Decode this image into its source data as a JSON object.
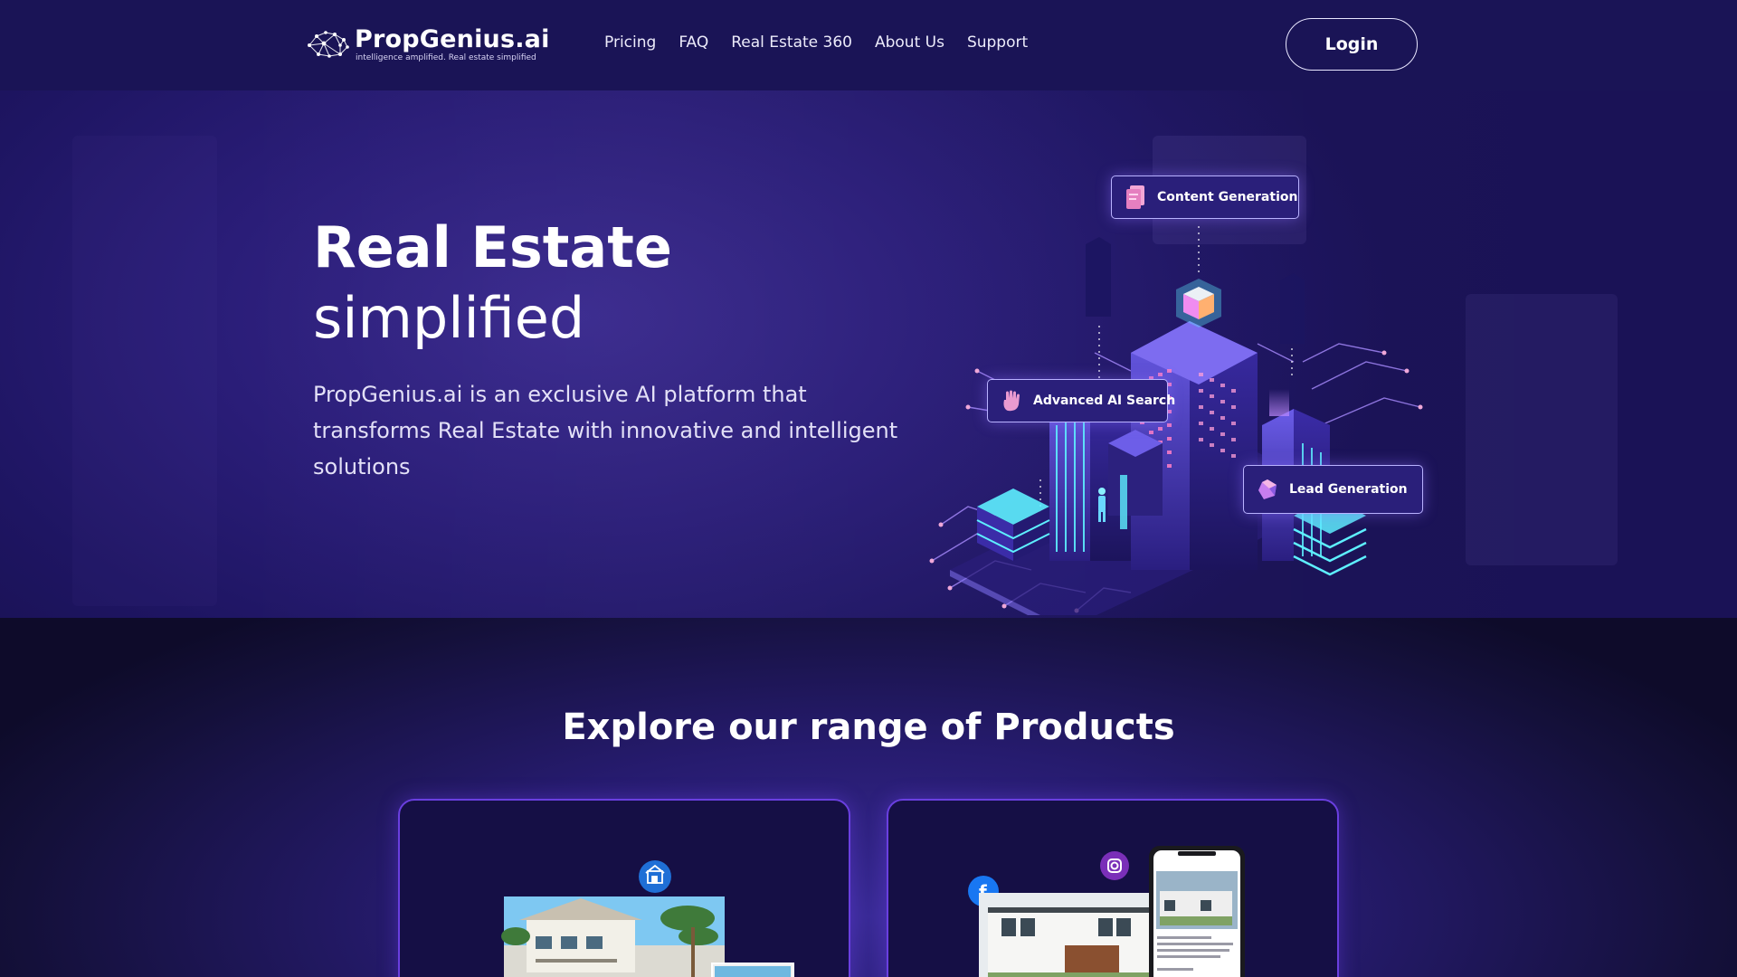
{
  "brand": {
    "name": "PropGenius.ai",
    "tagline": "intelligence amplified. Real estate simplified"
  },
  "nav": {
    "items": [
      {
        "label": "Pricing"
      },
      {
        "label": "FAQ"
      },
      {
        "label": "Real Estate 360"
      },
      {
        "label": "About Us"
      },
      {
        "label": "Support"
      }
    ],
    "login_label": "Login"
  },
  "hero": {
    "title": "Real Estate",
    "subtitle": "simplified",
    "description": "PropGenius.ai is an exclusive AI platform that transforms Real Estate with innovative and intelligent solutions",
    "features": [
      {
        "label": "Content Generation",
        "icon": "document-stack-icon"
      },
      {
        "label": "Advanced AI Search",
        "icon": "hand-pointer-icon"
      },
      {
        "label": "Lead Generation",
        "icon": "gem-icon"
      }
    ]
  },
  "products": {
    "heading": "Explore our range of Products",
    "cards": [
      {
        "icon": "building-icon"
      },
      {
        "icons": [
          "facebook-icon",
          "instagram-icon"
        ]
      }
    ]
  },
  "colors": {
    "header_bg": "#1a1456",
    "hero_bg": "#2a1d78",
    "card_border": "#6a3fe0",
    "accent_cyan": "#5ef0ff",
    "accent_pink": "#f08cf0"
  }
}
